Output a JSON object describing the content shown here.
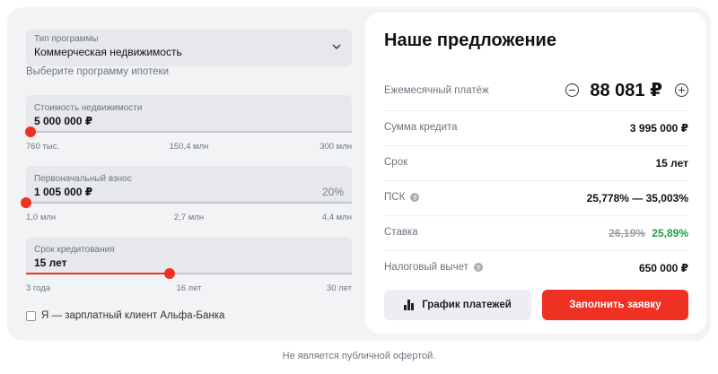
{
  "program": {
    "label": "Тип программы",
    "value": "Коммерческая недвижимость",
    "hint": "Выберите программу ипотеки"
  },
  "sliders": [
    {
      "label": "Стоимость недвижимости",
      "value": "5 000 000 ₽",
      "percent": "",
      "fill_fraction": 0.015,
      "ticks": [
        "760 тыс.",
        "150,4 млн",
        "300 млн"
      ]
    },
    {
      "label": "Первоначальный взнос",
      "value": "1 005 000 ₽",
      "percent": "20%",
      "fill_fraction": 0.0,
      "ticks": [
        "1,0 млн",
        "2,7 млн",
        "4,4 млн"
      ]
    },
    {
      "label": "Срок кредитования",
      "value": "15 лет",
      "percent": "",
      "fill_fraction": 0.44,
      "ticks": [
        "3 года",
        "16 лет",
        "30 лет"
      ]
    }
  ],
  "salary_checkbox": {
    "label": "Я — зарплатный клиент Альфа-Банка",
    "checked": false
  },
  "offer": {
    "title": "Наше предложение",
    "monthly_payment": {
      "label": "Ежемесячный платёж",
      "value": "88 081 ₽"
    },
    "loan_amount": {
      "label": "Сумма кредита",
      "value": "3 995 000 ₽"
    },
    "term": {
      "label": "Срок",
      "value": "15 лет"
    },
    "psk": {
      "label": "ПСК",
      "value": "25,778% — 35,003%"
    },
    "rate": {
      "label": "Ставка",
      "old_value": "26,19%",
      "new_value": "25,89%"
    },
    "tax_deduction": {
      "label": "Налоговый вычет",
      "value": "650 000 ₽"
    },
    "schedule_button": "График платежей",
    "apply_button": "Заполнить заявку"
  },
  "info_glyph": "?",
  "footnote": "Не является публичной офертой.",
  "colors": {
    "accent": "#ef3124",
    "rate_green": "#1f9d4c",
    "panel_bg": "#f2f3f5"
  }
}
